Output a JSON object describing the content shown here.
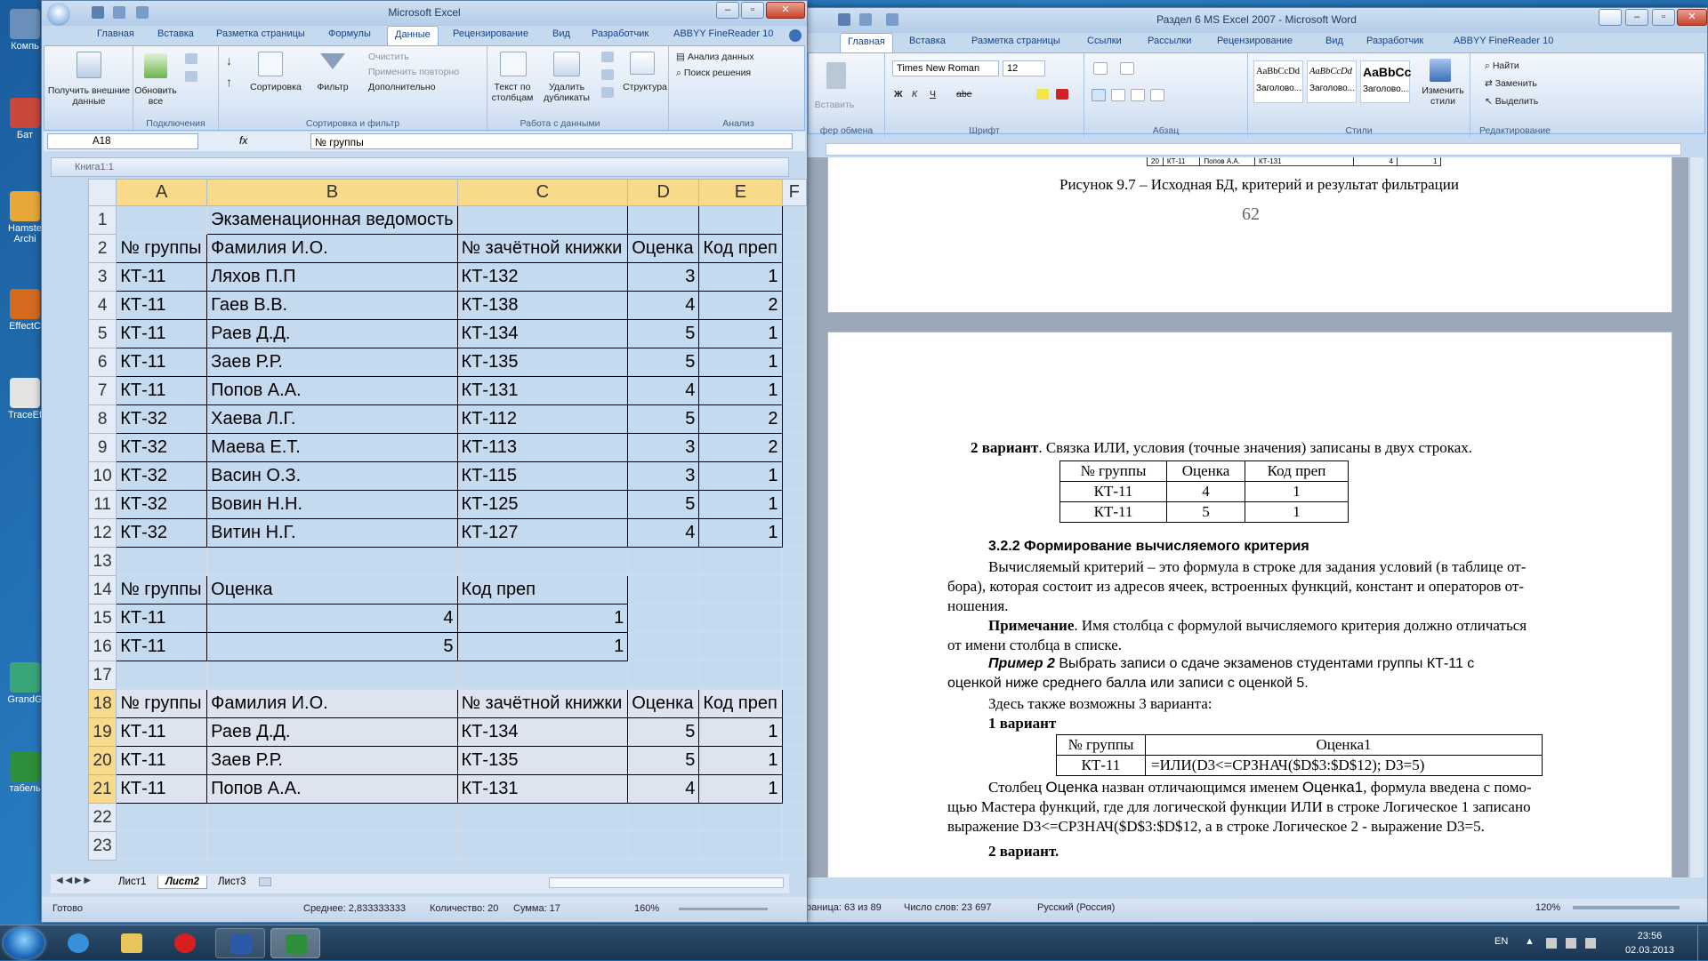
{
  "desktop": {
    "icons": [
      {
        "label": "Компь"
      },
      {
        "label": "Бат"
      },
      {
        "label": "Hamste Archi"
      },
      {
        "label": "EffectC"
      },
      {
        "label": "TraceEf"
      },
      {
        "label": "GrandG"
      },
      {
        "label": "табель"
      }
    ]
  },
  "excel": {
    "title": "Microsoft Excel",
    "tabs": [
      "Главная",
      "Вставка",
      "Разметка страницы",
      "Формулы",
      "Данные",
      "Рецензирование",
      "Вид",
      "Разработчик",
      "ABBYY FineReader 10"
    ],
    "active_tab": "Данные",
    "ribbon": {
      "get_external": "Получить внешние данные",
      "refresh_all": "Обновить все",
      "group_connections": "Подключения",
      "sort": "Сортировка",
      "filter": "Фильтр",
      "clear": "Очистить",
      "reapply": "Применить повторно",
      "advanced": "Дополнительно",
      "group_sort_filter": "Сортировка и фильтр",
      "text_to_columns": "Текст по столбцам",
      "remove_duplicates": "Удалить дубликаты",
      "group_data_tools": "Работа с данными",
      "outline": "Структура",
      "data_analysis": "Анализ данных",
      "solver": "Поиск решения",
      "group_analysis": "Анализ"
    },
    "name_box": "A18",
    "fx": "fx",
    "formula": "№ группы",
    "doc_title": "Книга1:1",
    "columns": [
      "A",
      "B",
      "C",
      "D",
      "E",
      "F"
    ],
    "rows": [
      {
        "n": "1",
        "cells": [
          "",
          "Экзаменационная ведомость",
          "",
          "",
          ""
        ]
      },
      {
        "n": "2",
        "cells": [
          "№ группы",
          "Фамилия И.О.",
          "№ зачётной книжки",
          "Оценка",
          "Код преп"
        ]
      },
      {
        "n": "3",
        "cells": [
          "КТ-11",
          "Ляхов П.П",
          "КТ-132",
          "3",
          "1"
        ]
      },
      {
        "n": "4",
        "cells": [
          "КТ-11",
          "Гаев В.В.",
          "КТ-138",
          "4",
          "2"
        ]
      },
      {
        "n": "5",
        "cells": [
          "КТ-11",
          "Раев Д.Д.",
          "КТ-134",
          "5",
          "1"
        ]
      },
      {
        "n": "6",
        "cells": [
          "КТ-11",
          "Заев Р.Р.",
          "КТ-135",
          "5",
          "1"
        ]
      },
      {
        "n": "7",
        "cells": [
          "КТ-11",
          "Попов А.А.",
          "КТ-131",
          "4",
          "1"
        ]
      },
      {
        "n": "8",
        "cells": [
          "КТ-32",
          "Хаева Л.Г.",
          "КТ-112",
          "5",
          "2"
        ]
      },
      {
        "n": "9",
        "cells": [
          "КТ-32",
          "Маева Е.Т.",
          "КТ-113",
          "3",
          "2"
        ]
      },
      {
        "n": "10",
        "cells": [
          "КТ-32",
          "Васин О.З.",
          "КТ-115",
          "3",
          "1"
        ]
      },
      {
        "n": "11",
        "cells": [
          "КТ-32",
          "Вовин Н.Н.",
          "КТ-125",
          "5",
          "1"
        ]
      },
      {
        "n": "12",
        "cells": [
          "КТ-32",
          "Витин Н.Г.",
          "КТ-127",
          "4",
          "1"
        ]
      },
      {
        "n": "13",
        "cells": [
          "",
          "",
          "",
          "",
          ""
        ]
      },
      {
        "n": "14",
        "cells": [
          "№ группы",
          "Оценка",
          "Код преп",
          "",
          ""
        ]
      },
      {
        "n": "15",
        "cells": [
          "КТ-11",
          "4",
          "1",
          "",
          ""
        ]
      },
      {
        "n": "16",
        "cells": [
          "КТ-11",
          "5",
          "1",
          "",
          ""
        ]
      },
      {
        "n": "17",
        "cells": [
          "",
          "",
          "",
          "",
          ""
        ]
      },
      {
        "n": "18",
        "cells": [
          "№ группы",
          "Фамилия И.О.",
          "№ зачётной книжки",
          "Оценка",
          "Код преп"
        ]
      },
      {
        "n": "19",
        "cells": [
          "КТ-11",
          "Раев Д.Д.",
          "КТ-134",
          "5",
          "1"
        ]
      },
      {
        "n": "20",
        "cells": [
          "КТ-11",
          "Заев Р.Р.",
          "КТ-135",
          "5",
          "1"
        ]
      },
      {
        "n": "21",
        "cells": [
          "КТ-11",
          "Попов А.А.",
          "КТ-131",
          "4",
          "1"
        ]
      },
      {
        "n": "22",
        "cells": [
          "",
          "",
          "",
          "",
          ""
        ]
      },
      {
        "n": "23",
        "cells": [
          "",
          "",
          "",
          "",
          ""
        ]
      }
    ],
    "sheets": [
      "Лист1",
      "Лист2",
      "Лист3"
    ],
    "active_sheet": "Лист2",
    "status": {
      "ready": "Готово",
      "average": "Среднее: 2,833333333",
      "count": "Количество: 20",
      "sum": "Сумма: 17",
      "zoom": "160%"
    }
  },
  "word": {
    "title": "Раздел 6 MS Excel 2007 - Microsoft Word",
    "tabs": [
      "Главная",
      "Вставка",
      "Разметка страницы",
      "Ссылки",
      "Рассылки",
      "Рецензирование",
      "Вид",
      "Разработчик",
      "ABBYY FineReader 10"
    ],
    "active_tab": "Главная",
    "ribbon": {
      "paste": "Вставить",
      "clipboard": "фер обмена",
      "font_name": "Times New Roman",
      "font_size": "12",
      "group_font": "Шрифт",
      "group_paragraph": "Абзац",
      "styles": [
        {
          "preview": "AaBbCcDd",
          "name": "Заголово..."
        },
        {
          "preview": "AaBbCcDd",
          "name": "Заголово..."
        },
        {
          "preview": "AaBbCc",
          "name": "Заголово..."
        }
      ],
      "change_styles": "Изменить стили",
      "group_styles": "Стили",
      "find": "Найти",
      "replace": "Заменить",
      "select": "Выделить",
      "group_editing": "Редактирование"
    },
    "page1": {
      "mini_row": [
        "20",
        "КТ-11",
        "Попов А.А.",
        "КТ-131",
        "4",
        "1"
      ],
      "caption": "Рисунок 9.7 – Исходная БД, критерий и результат фильтрации",
      "page_number": "62"
    },
    "page2": {
      "variant2_bold": "2 вариант",
      "variant2_text": ". Связка ИЛИ, условия (точные значения) записаны в двух строках.",
      "crit_table": [
        [
          "№ группы",
          "Оценка",
          "Код преп"
        ],
        [
          "КТ-11",
          "4",
          "1"
        ],
        [
          "КТ-11",
          "5",
          "1"
        ]
      ],
      "heading": "3.2.2 Формирование вычисляемого критерия",
      "p1_l1": "Вычисляемый критерий – это формула в строке для задания условий (в таблице от-",
      "p1_l2": "бора), которая состоит из адресов ячеек, встроенных функций, констант и операторов от-",
      "p1_l3": "ношения.",
      "note_bold": "Примечание",
      "note_l1": ". Имя столбца с формулой вычисляемого критерия должно отличаться",
      "note_l2": "от имени столбца в списке.",
      "ex_bold": "Пример 2",
      "ex_l1": " Выбрать записи о сдаче экзаменов студентами группы КТ-11 с",
      "ex_l2": "оценкой ниже среднего балла или записи с оценкой 5.",
      "here": "Здесь также возможны 3 варианта:",
      "var1": "1 вариант",
      "formula_table": [
        [
          "№ группы",
          "Оценка1"
        ],
        [
          "КТ-11",
          "=ИЛИ(D3<=СРЗНАЧ($D$3:$D$12); D3=5)"
        ]
      ],
      "after_l1a": "Столбец ",
      "after_l1b": "Оценка",
      "after_l1c": " назван отличающимся именем ",
      "after_l1d": "Оценка1",
      "after_l1e": ", формула введена с помо-",
      "after_l2": "щью Мастера функций, где для логической функции ИЛИ в строке Логическое 1 записано",
      "after_l3": "выражение D3<=СРЗНАЧ($D$3:$D$12, а в строке Логическое 2 - выражение D3=5.",
      "var2": "2 вариант."
    },
    "status": {
      "page": "раница: 63 из 89",
      "words": "Число слов: 23 697",
      "lang": "Русский (Россия)",
      "zoom": "120%"
    }
  },
  "taskbar": {
    "lang": "EN",
    "time": "23:56",
    "date": "02.03.2013"
  }
}
